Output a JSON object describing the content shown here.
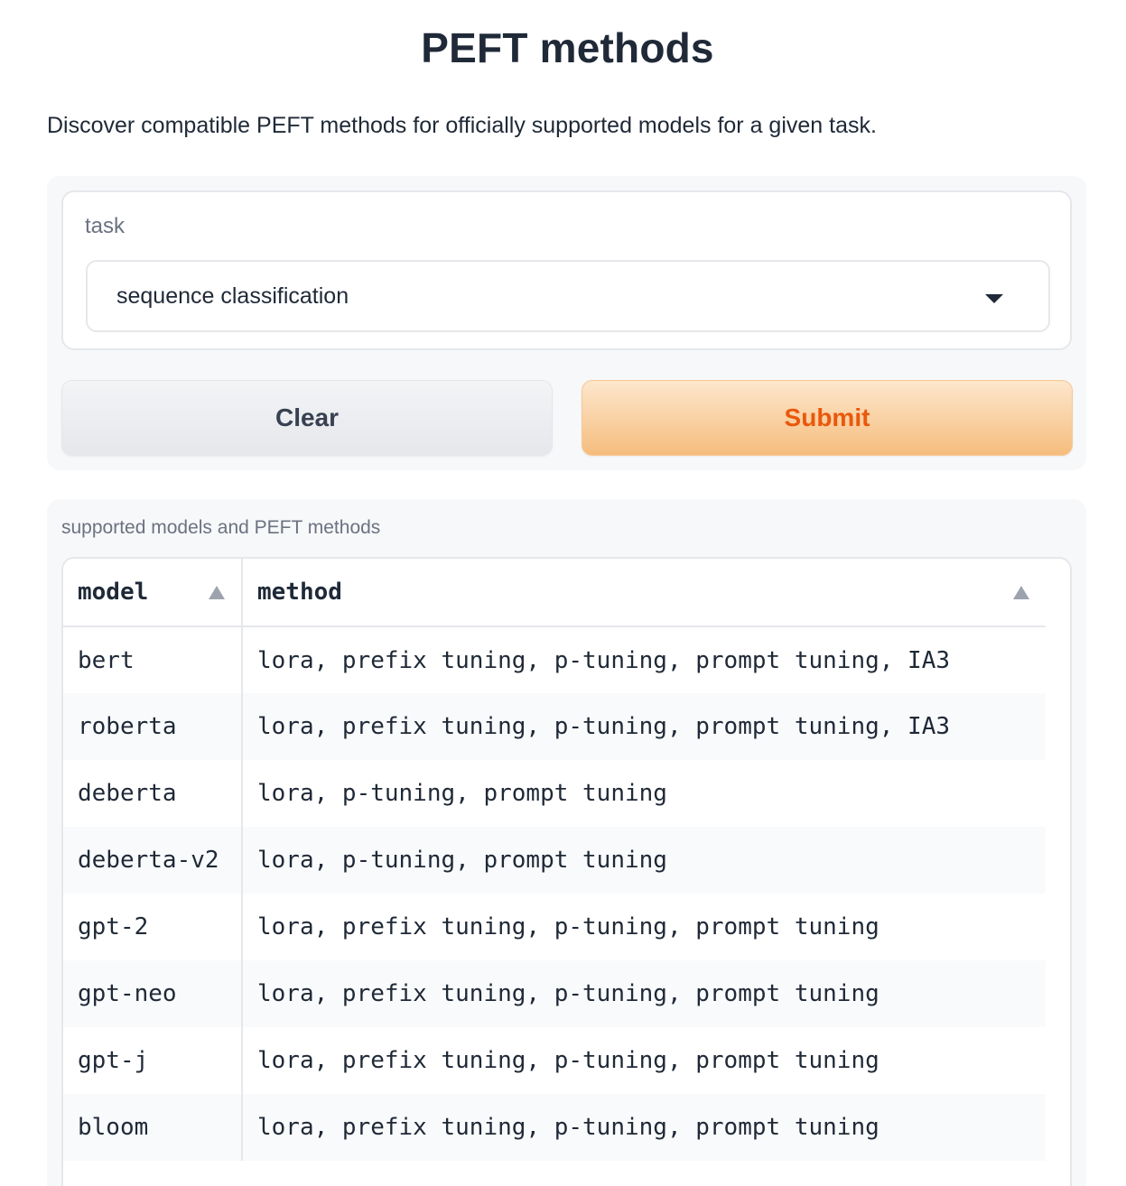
{
  "header": {
    "title": "PEFT methods",
    "description": "Discover compatible PEFT methods for officially supported models for a given task."
  },
  "form": {
    "task_label": "task",
    "task_value": "sequence classification",
    "clear_label": "Clear",
    "submit_label": "Submit"
  },
  "output": {
    "label": "supported models and PEFT methods",
    "columns": [
      "model",
      "method"
    ],
    "rows": [
      {
        "model": "bert",
        "method": "lora, prefix tuning, p-tuning, prompt tuning, IA3"
      },
      {
        "model": "roberta",
        "method": "lora, prefix tuning, p-tuning, prompt tuning, IA3"
      },
      {
        "model": "deberta",
        "method": "lora, p-tuning, prompt tuning"
      },
      {
        "model": "deberta-v2",
        "method": "lora, p-tuning, prompt tuning"
      },
      {
        "model": "gpt-2",
        "method": "lora, prefix tuning, p-tuning, prompt tuning"
      },
      {
        "model": "gpt-neo",
        "method": "lora, prefix tuning, p-tuning, prompt tuning"
      },
      {
        "model": "gpt-j",
        "method": "lora, prefix tuning, p-tuning, prompt tuning"
      },
      {
        "model": "bloom",
        "method": "lora, prefix tuning, p-tuning, prompt tuning"
      }
    ]
  },
  "icons": {
    "select_caret": "chevron-down-icon",
    "sort": "sort-ascending-icon"
  },
  "colors": {
    "submit_text": "#ea580c",
    "submit_bg": "#f5bd7e",
    "panel_bg": "#f7f8fa"
  }
}
